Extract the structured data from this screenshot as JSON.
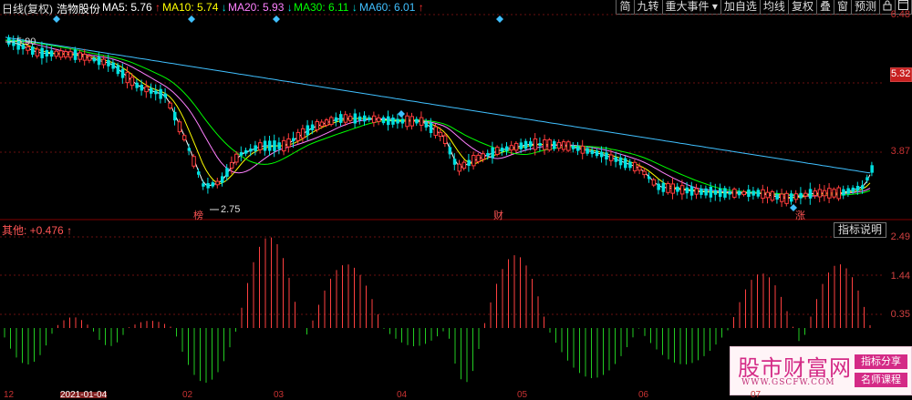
{
  "header": {
    "title": "日线(复权)",
    "stock_name": "浩物股份",
    "ma": [
      {
        "label": "MA5: 5.76",
        "arrow": "↑",
        "color": "#ffffff"
      },
      {
        "label": "MA10: 5.74",
        "arrow": "↓",
        "color": "#ffff00"
      },
      {
        "label": "MA20: 5.93",
        "arrow": "↓",
        "color": "#ff80ff"
      },
      {
        "label": "MA30: 6.11",
        "arrow": "↓",
        "color": "#00ff00"
      },
      {
        "label": "MA60: 6.01",
        "arrow": "↑",
        "color": "#40c0ff"
      }
    ]
  },
  "toolbar": {
    "buttons": [
      "简",
      "九转",
      "重大事件",
      "加自选",
      "均线",
      "复权",
      "叠",
      "窗",
      "预测"
    ],
    "lock_icon": "lock-icon",
    "window_icon": "window-icon"
  },
  "price_axis": {
    "top": "6.48",
    "current": "5.32",
    "mid": "3.87"
  },
  "annotations": {
    "high_label": "5.90",
    "low_label": "2.75",
    "badge1": "榜",
    "badge2": "财",
    "badge3": "涨"
  },
  "indicator": {
    "label": "其他: +0.476",
    "arrow": "↑",
    "button": "指标说明",
    "axis": [
      "2.49",
      "1.44",
      "0.35"
    ]
  },
  "watermark": {
    "main": "股市财富网",
    "url": "WWW.GSCFW.COM",
    "tag1": "指标分享",
    "tag2": "名师课程"
  },
  "dates": [
    "12",
    "2021-01-04",
    "02",
    "03",
    "04",
    "05",
    "06",
    "07"
  ],
  "colors": {
    "up": "#ff3c3c",
    "down": "#00e0e0",
    "hist_up": "#ff4040",
    "hist_dn": "#22cc22"
  }
}
